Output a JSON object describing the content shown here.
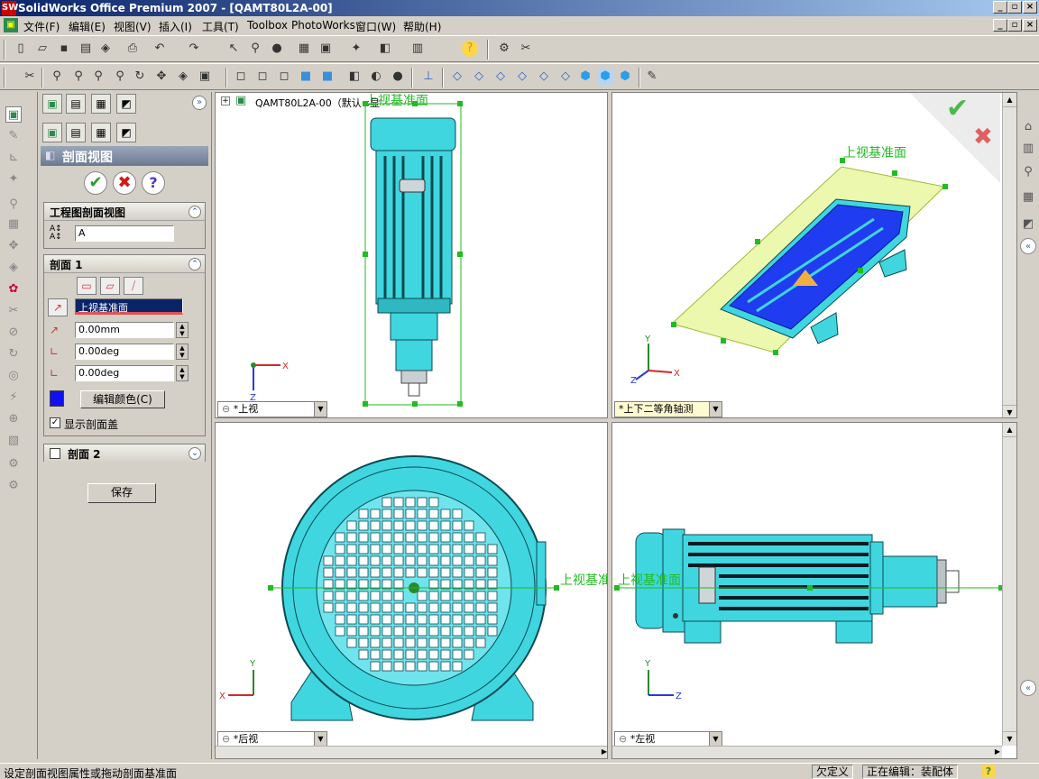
{
  "window": {
    "title": "SolidWorks Office Premium 2007 - [QAMT80L2A-00]"
  },
  "menu": [
    "文件(F)",
    "编辑(E)",
    "视图(V)",
    "插入(I)",
    "工具(T)",
    "Toolbox",
    "PhotoWorks",
    "窗口(W)",
    "帮助(H)"
  ],
  "property_manager": {
    "title": "剖面视图",
    "group_drawing": {
      "label": "工程图剖面视图",
      "name_value": "A"
    },
    "group_section1": {
      "label": "剖面 1",
      "plane": "上视基准面",
      "offset": "0.00mm",
      "angle_x": "0.00deg",
      "angle_y": "0.00deg",
      "edit_color": "编辑颜色(C)",
      "show_cap": "显示剖面盖",
      "show_cap_checked": true
    },
    "group_section2": {
      "label": "剖面 2"
    },
    "save": "保存"
  },
  "tree": {
    "root": "QAMT80L2A-00（默认<显"
  },
  "viewports": {
    "top_left": {
      "view": "*上视",
      "plane_label": "上视基准面"
    },
    "top_right": {
      "view": "*上下二等角轴测",
      "plane_label": "上视基准面"
    },
    "bottom_left": {
      "view": "*后视",
      "plane_label": "上视基准"
    },
    "bottom_right": {
      "view": "*左视",
      "plane_label": "上视基准面"
    }
  },
  "axes": {
    "x": "X",
    "y": "Y",
    "z": "Z"
  },
  "status": {
    "message": "设定剖面视图属性或拖动剖面基准面",
    "underdefined": "欠定义",
    "editing": "正在编辑：装配体"
  },
  "colors": {
    "model": "#3fd6e0",
    "model_dark": "#1b8a96",
    "plane": "#e8f7a0",
    "section": "#1f3cf0",
    "accent": "#22bb22"
  }
}
